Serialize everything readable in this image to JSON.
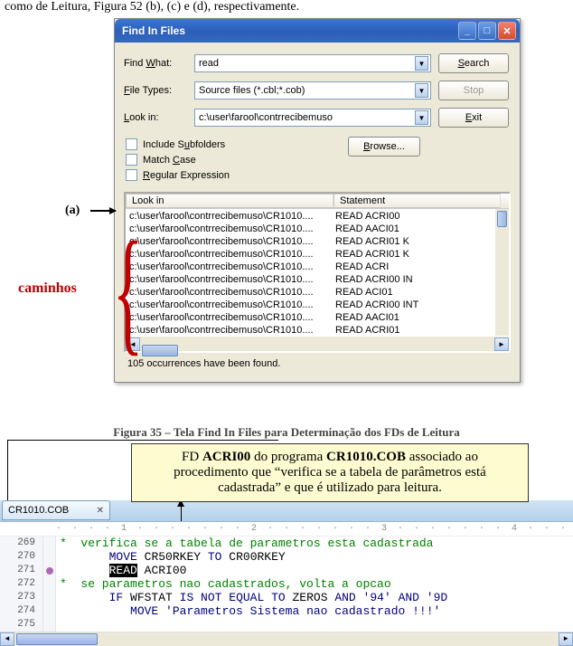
{
  "top_fragment": "como de Leitura, Figura 52 (b), (c) e (d), respectivamente.",
  "dialog": {
    "title": "Find In Files",
    "labels": {
      "find_what_pre": "Find ",
      "find_what_u": "W",
      "find_what_post": "hat:",
      "file_types_pre": "",
      "file_types_u": "F",
      "file_types_post": "ile Types:",
      "look_in_pre": "",
      "look_in_u": "L",
      "look_in_post": "ook in:",
      "include_sub_pre": "Include S",
      "include_sub_u": "u",
      "include_sub_post": "bfolders",
      "match_case_pre": "Match ",
      "match_case_u": "C",
      "match_case_post": "ase",
      "regex_pre": "",
      "regex_u": "R",
      "regex_post": "egular Expression"
    },
    "values": {
      "find_what": "read",
      "file_types": "Source files (*.cbl;*.cob)",
      "look_in": "c:\\user\\farool\\contrrecibemuso"
    },
    "buttons": {
      "search_u": "S",
      "search_post": "earch",
      "stop": "Stop",
      "exit_u": "E",
      "exit_post": "xit",
      "browse_u": "B",
      "browse_post": "rowse..."
    },
    "results": {
      "col1": "Look in",
      "col2": "Statement",
      "rows": [
        {
          "path": "c:\\user\\farool\\contrrecibemuso\\CR1010....",
          "stmt": "READ ACRI00"
        },
        {
          "path": "c:\\user\\farool\\contrrecibemuso\\CR1010....",
          "stmt": "READ AACI01"
        },
        {
          "path": "c:\\user\\farool\\contrrecibemuso\\CR1010....",
          "stmt": "     READ ACRI01 K"
        },
        {
          "path": "c:\\user\\farool\\contrrecibemuso\\CR1010....",
          "stmt": "READ ACRI01 K"
        },
        {
          "path": "c:\\user\\farool\\contrrecibemuso\\CR1010....",
          "stmt": "       READ ACRI"
        },
        {
          "path": "c:\\user\\farool\\contrrecibemuso\\CR1010....",
          "stmt": "READ ACRI00 IN"
        },
        {
          "path": "c:\\user\\farool\\contrrecibemuso\\CR1010....",
          "stmt": "      READ ACI01"
        },
        {
          "path": "c:\\user\\farool\\contrrecibemuso\\CR1010....",
          "stmt": "READ ACRI00 INT"
        },
        {
          "path": "c:\\user\\farool\\contrrecibemuso\\CR1010....",
          "stmt": "READ AACI01"
        },
        {
          "path": "c:\\user\\farool\\contrrecibemuso\\CR1010....",
          "stmt": "READ ACRI01"
        }
      ]
    },
    "status": "105 occurrences have been found."
  },
  "annotations": {
    "a": "(a)",
    "caminhos": "caminhos",
    "figcap": "Figura 35 – Tela Find In Files para Determinação dos FDs de Leitura",
    "callout_l1a": "FD  ",
    "callout_l1b": "ACRI00",
    "callout_l1c": "  do programa ",
    "callout_l1d": "CR1010.COB",
    "callout_l1e": " associado ao",
    "callout_l2": "procedimento que “verifica se a tabela de parâmetros está",
    "callout_l3": "cadastrada” e que é utilizado para leitura."
  },
  "editor": {
    "tab": "CR1010.COB",
    "lines": [
      {
        "n": "269",
        "mark": false,
        "html": "<span class='cm-comment'>*  verifica se a tabela de parametros esta cadastrada</span>"
      },
      {
        "n": "270",
        "mark": false,
        "html": "       <span class='cm-kw'>MOVE</span> <span class='cm-id'>CR50RKEY</span> <span class='cm-kw'>TO</span> <span class='cm-id'>CR00RKEY</span>"
      },
      {
        "n": "271",
        "mark": true,
        "html": "       <span class='cm-hl'>READ</span> <span class='cm-id'>ACRI00</span>"
      },
      {
        "n": "272",
        "mark": false,
        "html": "<span class='cm-comment'>*  se parametros nao cadastrados, volta a opcao</span>"
      },
      {
        "n": "273",
        "mark": false,
        "html": "       <span class='cm-kw'>IF</span> <span class='cm-id'>WFSTAT</span> <span class='cm-kw'>IS NOT EQUAL TO</span> <span class='cm-id'>ZEROS</span> <span class='cm-kw'>AND</span> <span class='cm-str'>'94'</span> <span class='cm-kw'>AND</span> <span class='cm-str'>'9D</span>"
      },
      {
        "n": "274",
        "mark": false,
        "html": "          <span class='cm-kw'>MOVE</span> <span class='cm-str'>'Parametros Sistema nao cadastrado !!!'</span>"
      },
      {
        "n": "275",
        "mark": false,
        "html": ""
      }
    ]
  }
}
